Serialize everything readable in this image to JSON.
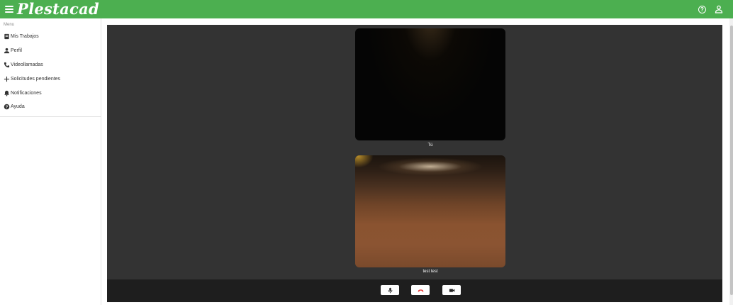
{
  "topbar": {
    "menu_icon": "hamburger-menu-icon",
    "logo_text": "Plestacad",
    "help_icon": "help-circle-icon",
    "account_icon": "account-icon",
    "bar_color": "#4caf50"
  },
  "sidebar": {
    "caption": "Menu",
    "items": [
      {
        "label": "Mis Trabajos",
        "icon": "book-icon"
      },
      {
        "label": "Perfil",
        "icon": "person-icon"
      },
      {
        "label": "Videollamadas",
        "icon": "phone-icon"
      },
      {
        "label": "Solicitudes pendientes",
        "icon": "plus-icon"
      },
      {
        "label": "Notificaciones",
        "icon": "bell-icon"
      },
      {
        "label": "Ayuda",
        "icon": "help-icon"
      }
    ]
  },
  "call": {
    "self_label": "Tú",
    "remote_label": "test test",
    "controls": {
      "mic_icon": "microphone-icon",
      "hangup_icon": "hang-up-icon",
      "camera_icon": "video-camera-icon",
      "hangup_color": "#e53935"
    }
  }
}
